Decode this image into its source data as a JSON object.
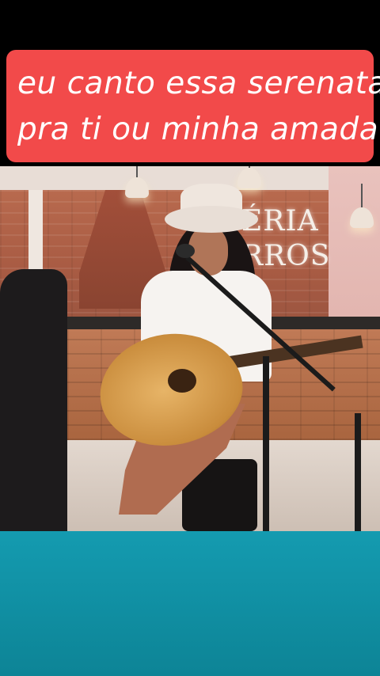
{
  "caption": {
    "lines": [
      "eu canto essa serenata",
      "pra ti ou minha amada"
    ],
    "background_color": "#f24a4a",
    "text_color": "#ffffff"
  },
  "video": {
    "sign_text": [
      "ÉRIA",
      "RROS"
    ]
  },
  "bottom_area": {
    "color": "#149bb0"
  }
}
